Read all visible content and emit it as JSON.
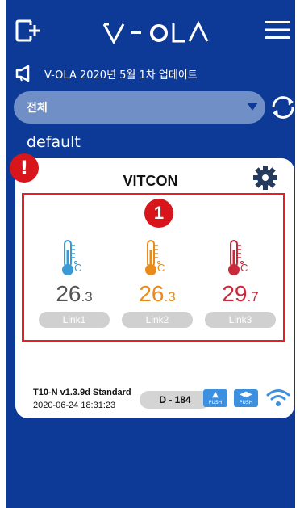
{
  "header": {
    "logo_text": "V-OLA",
    "add_device_icon": "add-device-icon",
    "menu_icon": "hamburger-menu-icon"
  },
  "notice": {
    "icon": "megaphone-icon",
    "text": "V-OLA 2020년 5월 1차 업데이트"
  },
  "group_filter": {
    "selected": "전체",
    "refresh_icon": "refresh-icon"
  },
  "section": {
    "title": "default"
  },
  "device_card": {
    "alert_badge": "!",
    "name": "VITCON",
    "step_badge": "1",
    "sensors": [
      {
        "int": "26",
        "dec": ".3",
        "link": "Link1",
        "color": "#3a9ad6"
      },
      {
        "int": "26",
        "dec": ".3",
        "link": "Link2",
        "color": "#e88b1a"
      },
      {
        "int": "29",
        "dec": ".7",
        "link": "Link3",
        "color": "#c82a3a"
      }
    ],
    "firmware": "T10-N v1.3.9d Standard",
    "timestamp": "2020-06-24 18:31:23",
    "device_id": "D - 184",
    "push_label_1": "PUSH",
    "push_label_2": "PUSH"
  },
  "colors": {
    "background": "#0d3a96",
    "select": "#6f8fc6",
    "highlight": "#e81e25",
    "badge": "#d8151b"
  }
}
